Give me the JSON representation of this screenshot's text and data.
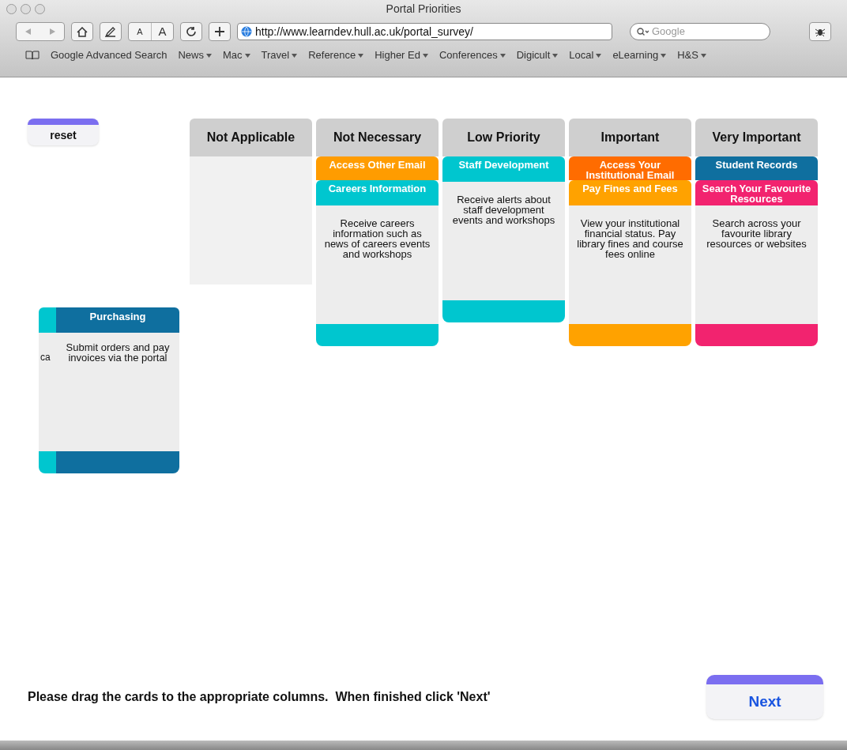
{
  "window": {
    "title": "Portal Priorities"
  },
  "toolbar": {
    "url": "http://www.learndev.hull.ac.uk/portal_survey/",
    "search_placeholder": "Google",
    "text_small": "A",
    "text_large": "A"
  },
  "bookmarks": [
    {
      "label": "Google Advanced Search",
      "menu": false
    },
    {
      "label": "News",
      "menu": true
    },
    {
      "label": "Mac",
      "menu": true
    },
    {
      "label": "Travel",
      "menu": true
    },
    {
      "label": "Reference",
      "menu": true
    },
    {
      "label": "Higher Ed",
      "menu": true
    },
    {
      "label": "Conferences",
      "menu": true
    },
    {
      "label": "Digicult",
      "menu": true
    },
    {
      "label": "Local",
      "menu": true
    },
    {
      "label": "eLearning",
      "menu": true
    },
    {
      "label": "H&S",
      "menu": true
    }
  ],
  "reset_button": "reset",
  "columns": [
    {
      "title": "Not Applicable"
    },
    {
      "title": "Not Necessary",
      "cards": [
        {
          "title": "Access Other Email",
          "color": "#ff9c00"
        },
        {
          "title": "Careers Information",
          "color": "#00c6cf",
          "description": "Receive careers information such as news of careers events and workshops"
        }
      ]
    },
    {
      "title": "Low Priority",
      "cards": [
        {
          "title": "Staff Development",
          "color": "#00c6cf",
          "description": "Receive alerts about staff development events and workshops"
        }
      ]
    },
    {
      "title": "Important",
      "cards": [
        {
          "title": "Access Your Institutional Email",
          "color": "#ff6c00"
        },
        {
          "title": "Pay Fines and Fees",
          "color": "#ffa200",
          "description": "View your institutional financial status. Pay library fines and course fees online"
        }
      ]
    },
    {
      "title": "Very Important",
      "cards": [
        {
          "title": "Student Records",
          "color": "#0f6f9f"
        },
        {
          "title": "Search Your Favourite Resources",
          "color": "#f2236f",
          "description": "Search across your favourite library resources or websites"
        }
      ]
    }
  ],
  "loose_cards": [
    {
      "color": "#00c6cf",
      "description_fragment": "ca"
    },
    {
      "title": "Purchasing",
      "color": "#0f6f9f",
      "description": "Submit orders and pay invoices via the portal"
    }
  ],
  "instructions": "Please drag the cards to the appropriate columns.  When finished click 'Next'",
  "next_button": "Next"
}
